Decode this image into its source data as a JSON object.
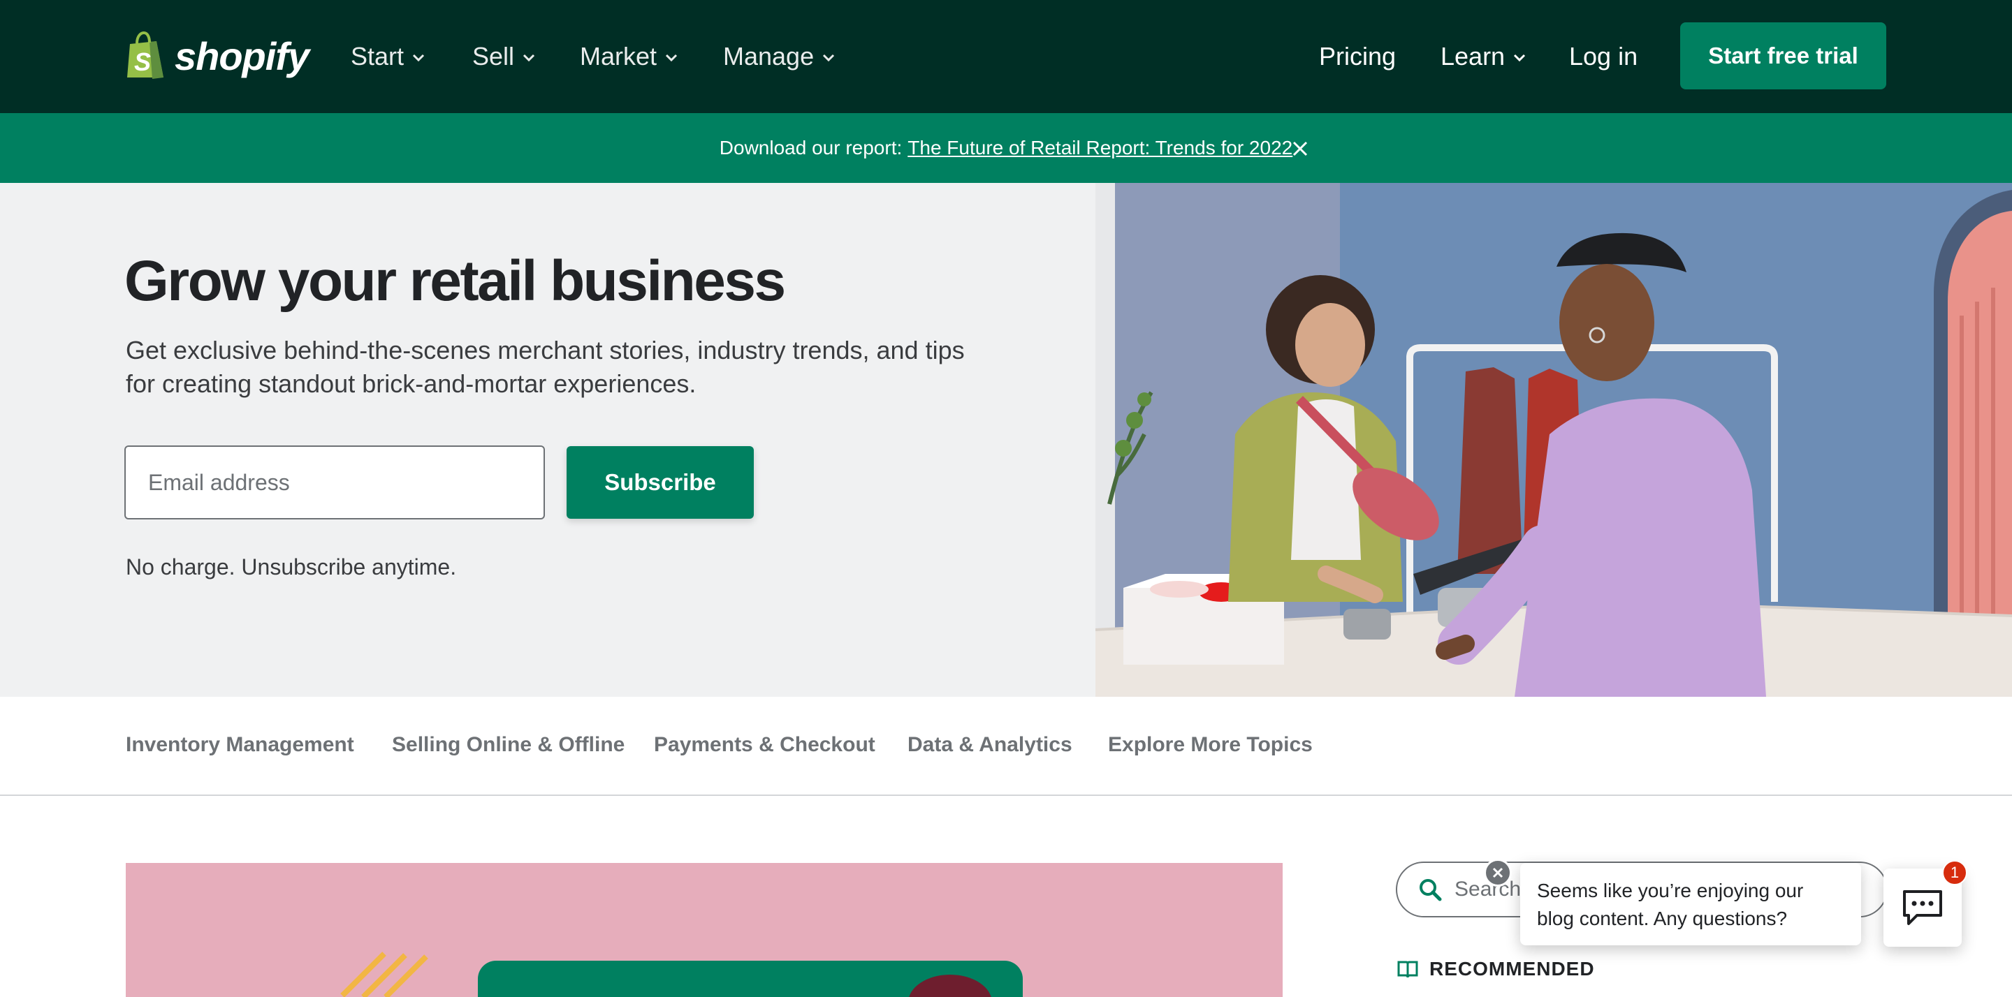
{
  "nav": {
    "logo_text": "shopify",
    "logo_icon": "shopping-bag-icon",
    "menu": [
      {
        "label": "Start"
      },
      {
        "label": "Sell"
      },
      {
        "label": "Market"
      },
      {
        "label": "Manage"
      }
    ],
    "pricing": "Pricing",
    "learn": "Learn",
    "login": "Log in",
    "cta": "Start free trial"
  },
  "banner": {
    "prefix": "Download our report:",
    "link": "The Future of Retail Report: Trends for 2022"
  },
  "hero": {
    "title": "Grow your retail business",
    "subtitle": "Get exclusive behind-the-scenes merchant stories, industry trends, and tips for creating standout brick-and-mortar experiences.",
    "email_placeholder": "Email address",
    "subscribe": "Subscribe",
    "note": "No charge. Unsubscribe anytime."
  },
  "topics": [
    "Inventory Management",
    "Selling Online & Offline",
    "Payments & Checkout",
    "Data & Analytics",
    "Explore More Topics"
  ],
  "sidebar": {
    "search_placeholder": "Search",
    "recommended": "RECOMMENDED"
  },
  "chat": {
    "message": "Seems like you’re enjoying our blog content. Any questions?",
    "badge": "1"
  },
  "colors": {
    "nav_bg": "#002e25",
    "accent": "#008060",
    "hero_bg": "#f0f1f2",
    "card_pink": "#e6adbb"
  }
}
